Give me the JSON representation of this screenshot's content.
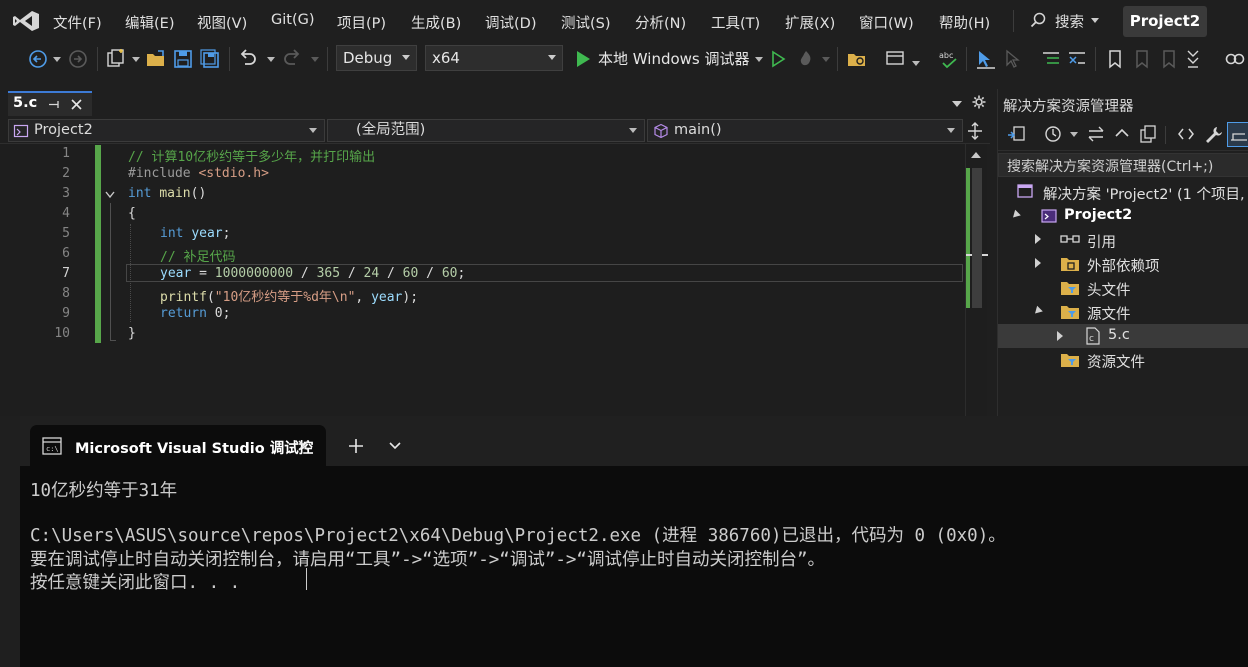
{
  "menu": {
    "items": [
      "文件(F)",
      "编辑(E)",
      "视图(V)",
      "Git(G)",
      "项目(P)",
      "生成(B)",
      "调试(D)",
      "测试(S)",
      "分析(N)",
      "工具(T)",
      "扩展(X)",
      "窗口(W)",
      "帮助(H)"
    ],
    "search_label": "搜索",
    "project_title": "Project2"
  },
  "toolbar": {
    "config": "Debug",
    "platform": "x64",
    "run_label": "本地 Windows 调试器"
  },
  "editor_tab": {
    "label": "5.c"
  },
  "navbar": {
    "project": "Project2",
    "scope": "(全局范围)",
    "function": "main()"
  },
  "code": {
    "line_numbers": [
      "1",
      "2",
      "3",
      "4",
      "5",
      "6",
      "7",
      "8",
      "9",
      "10"
    ],
    "current_line": "7",
    "lines": {
      "l1": "// 计算10亿秒约等于多少年，并打印输出",
      "l2a": "#include ",
      "l2b": "<stdio.h>",
      "l3a": "int",
      "l3b": "main",
      "l3c": "()",
      "l4": "{",
      "l5a": "int",
      "l5b": "year",
      "l5c": ";",
      "l6": "// 补足代码",
      "l7a": "year",
      "l7b": " = ",
      "l7c": "1000000000",
      "l7d": " / ",
      "l7e": "365",
      "l7f": " / ",
      "l7g": "24",
      "l7h": " / ",
      "l7i": "60",
      "l7j": " / ",
      "l7k": "60",
      "l7l": ";",
      "l8a": "printf",
      "l8b": "(",
      "l8c": "\"10亿秒约等于%d年\\n\"",
      "l8d": ", ",
      "l8e": "year",
      "l8f": ");",
      "l9a": "return",
      "l9b": " 0;",
      "l10": "}"
    }
  },
  "solution_explorer": {
    "title": "解决方案资源管理器",
    "search_placeholder": "搜索解决方案资源管理器(Ctrl+;)",
    "solution": "解决方案 'Project2' (1 个项目,",
    "project": "Project2",
    "references": "引用",
    "external_deps": "外部依赖项",
    "header_files": "头文件",
    "source_files": "源文件",
    "file_5c": "5.c",
    "resource_files": "资源文件"
  },
  "console": {
    "tab_title": "Microsoft Visual Studio 调试控",
    "output_line1": "10亿秒约等于31年",
    "output_line2": "C:\\Users\\ASUS\\source\\repos\\Project2\\x64\\Debug\\Project2.exe (进程 386760)已退出，代码为 0 (0x0)。",
    "output_line3": "要在调试停止时自动关闭控制台，请启用“工具”->“选项”->“调试”->“调试停止时自动关闭控制台”。",
    "output_line4": "按任意键关闭此窗口. . ."
  },
  "colors": {
    "accent_green": "#57a64a",
    "tab_accent": "#3d7bd6",
    "keyword": "#569cd6",
    "comment": "#57a64a"
  }
}
